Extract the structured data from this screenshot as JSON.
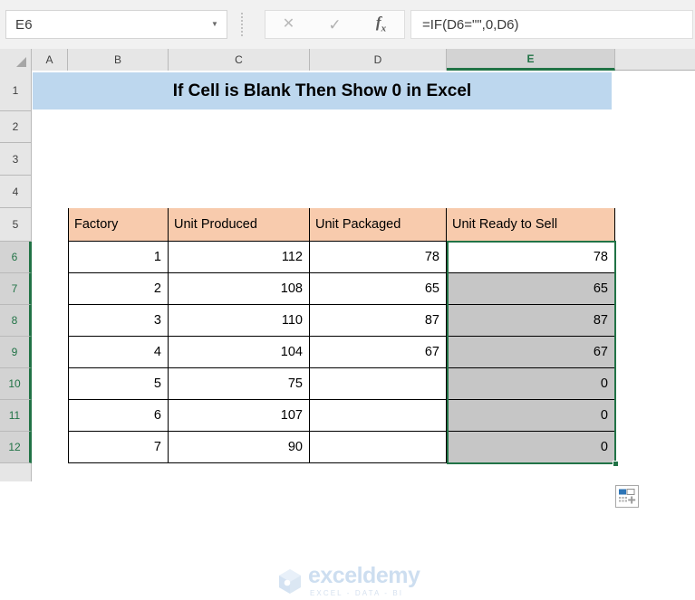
{
  "formula_bar": {
    "name_box_value": "E6",
    "name_box_arrow": "▼",
    "cancel_icon": "✕",
    "enter_icon": "✓",
    "fx_icon": "fx",
    "formula_value": "=IF(D6=\"\",0,D6)"
  },
  "sheet": {
    "column_headers": [
      "A",
      "B",
      "C",
      "D",
      "E"
    ],
    "selected_column": "E",
    "row_headers": [
      "1",
      "2",
      "3",
      "4",
      "5",
      "6",
      "7",
      "8",
      "9",
      "10",
      "11",
      "12"
    ],
    "selected_rows": [
      "6",
      "7",
      "8",
      "9",
      "10",
      "11",
      "12"
    ],
    "title_banner": "If Cell is Blank Then Show 0 in Excel",
    "table_headers": [
      "Factory",
      "Unit Produced",
      "Unit Packaged",
      "Unit Ready to Sell"
    ],
    "table_rows": [
      {
        "factory": "1",
        "produced": "112",
        "packaged": "78",
        "ready": "78"
      },
      {
        "factory": "2",
        "produced": "108",
        "packaged": "65",
        "ready": "65"
      },
      {
        "factory": "3",
        "produced": "110",
        "packaged": "87",
        "ready": "87"
      },
      {
        "factory": "4",
        "produced": "104",
        "packaged": "67",
        "ready": "67"
      },
      {
        "factory": "5",
        "produced": "75",
        "packaged": "",
        "ready": "0"
      },
      {
        "factory": "6",
        "produced": "107",
        "packaged": "",
        "ready": "0"
      },
      {
        "factory": "7",
        "produced": "90",
        "packaged": "",
        "ready": "0"
      }
    ],
    "autofill_button_label": "Auto Fill Options"
  },
  "watermark": {
    "name": "exceldemy",
    "tagline": "EXCEL - DATA - BI"
  },
  "colors": {
    "title_banner_fill": "#BDD7EE",
    "table_header_fill": "#F8CBAD",
    "selection_green": "#217346",
    "selected_cell_gray": "#C6C6C6",
    "header_band": "#E6E6E6"
  }
}
